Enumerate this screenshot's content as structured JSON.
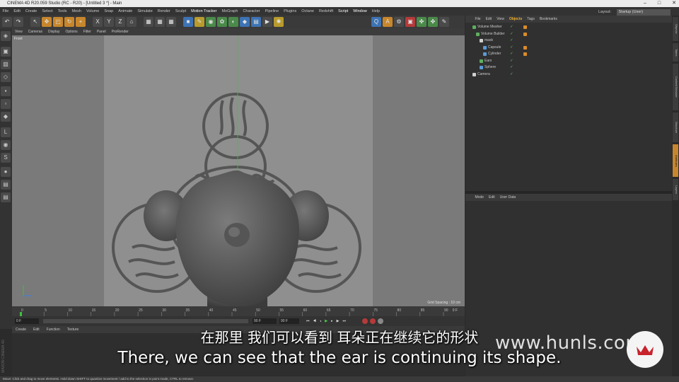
{
  "window": {
    "title": "CINEMA 4D R20.059 Studio (RC - R20) - [Untitled 3 *] - Main"
  },
  "menu": [
    "File",
    "Edit",
    "Create",
    "Select",
    "Tools",
    "Mesh",
    "Volume",
    "Snap",
    "Animate",
    "Simulate",
    "Render",
    "Sculpt",
    "Motion Tracker",
    "MoGraph",
    "Character",
    "Pipeline",
    "Plugins",
    "Octane",
    "Redshift",
    "Script",
    "Window",
    "Help"
  ],
  "layout": {
    "label": "Layout:",
    "value": "Startup (User)"
  },
  "viewport": {
    "menu": [
      "View",
      "Cameras",
      "Display",
      "Options",
      "Filter",
      "Panel",
      "ProRender"
    ],
    "label": "Front",
    "grid_spacing": "Grid Spacing : 10 cm"
  },
  "timeline": {
    "ticks": [
      "0",
      "5",
      "10",
      "15",
      "20",
      "25",
      "30",
      "35",
      "40",
      "45",
      "50",
      "55",
      "60",
      "65",
      "70",
      "75",
      "80",
      "85",
      "90"
    ],
    "end_frame": "0 F",
    "start_field": "0 F",
    "current_field": "0 F",
    "end_field": "90 F",
    "end_field2": "90 F"
  },
  "material": {
    "menu": [
      "Create",
      "Edit",
      "Function",
      "Texture"
    ]
  },
  "brand": "MAXON CINEMA 4D",
  "objects": {
    "menu": [
      "File",
      "Edit",
      "View",
      "Objects",
      "Tags",
      "Bookmarks"
    ],
    "active": "Objects",
    "items": [
      {
        "name": "Volume Mesher",
        "indent": 0,
        "color": "#5fae5f",
        "tag": true
      },
      {
        "name": "Volume Builder",
        "indent": 1,
        "color": "#5fae5f",
        "tag": true
      },
      {
        "name": "mask",
        "indent": 2,
        "color": "#d0d0d0",
        "tag": false
      },
      {
        "name": "Capsule",
        "indent": 3,
        "color": "#5a9ad6",
        "tag": true
      },
      {
        "name": "Cylinder",
        "indent": 3,
        "color": "#5a9ad6",
        "tag": true
      },
      {
        "name": "Ears",
        "indent": 2,
        "color": "#5fae5f",
        "tag": false
      },
      {
        "name": "Sphere",
        "indent": 2,
        "color": "#5a9ad6",
        "tag": false
      },
      {
        "name": "Camera",
        "indent": 0,
        "color": "#d0d0d0",
        "tag": false
      }
    ]
  },
  "attributes": {
    "menu": [
      "Mode",
      "Edit",
      "User Data"
    ]
  },
  "side_tabs": [
    "Objects",
    "Takes",
    "Content Browser",
    "Structure",
    "Attributes",
    "Layers"
  ],
  "status": "Move: Click and drag to move elements. Hold down SHIFT to quantize movement / add to the selection in point mode, CTRL to remove.",
  "subtitles": {
    "cn": "在那里 我们可以看到 耳朵正在继续它的形状",
    "en": "There, we can see that the ear is continuing its shape."
  },
  "watermark": "www.hunls.com"
}
